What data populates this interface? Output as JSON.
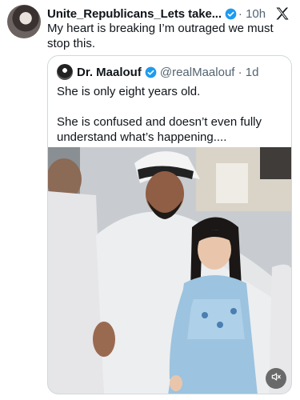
{
  "tweet": {
    "author_name": "Unite_Republicans_Lets take...",
    "separator_time": "· 10h",
    "text": "My heart is breaking I’m outraged we must stop this."
  },
  "quoted": {
    "name": "Dr. Maalouf",
    "handle_time": "@realMaalouf · 1d",
    "line1": "She is only eight years old.",
    "line2": "She is confused and doesn’t even fully understand what’s happening...."
  },
  "icons": {
    "avatar": "avatar",
    "verified": "verified-badge-icon",
    "x_logo": "x-logo-icon",
    "mute": "mute-icon"
  },
  "colors": {
    "verified": "#1d9bf0",
    "secondary_text": "#536471",
    "border": "#cfd9de"
  }
}
